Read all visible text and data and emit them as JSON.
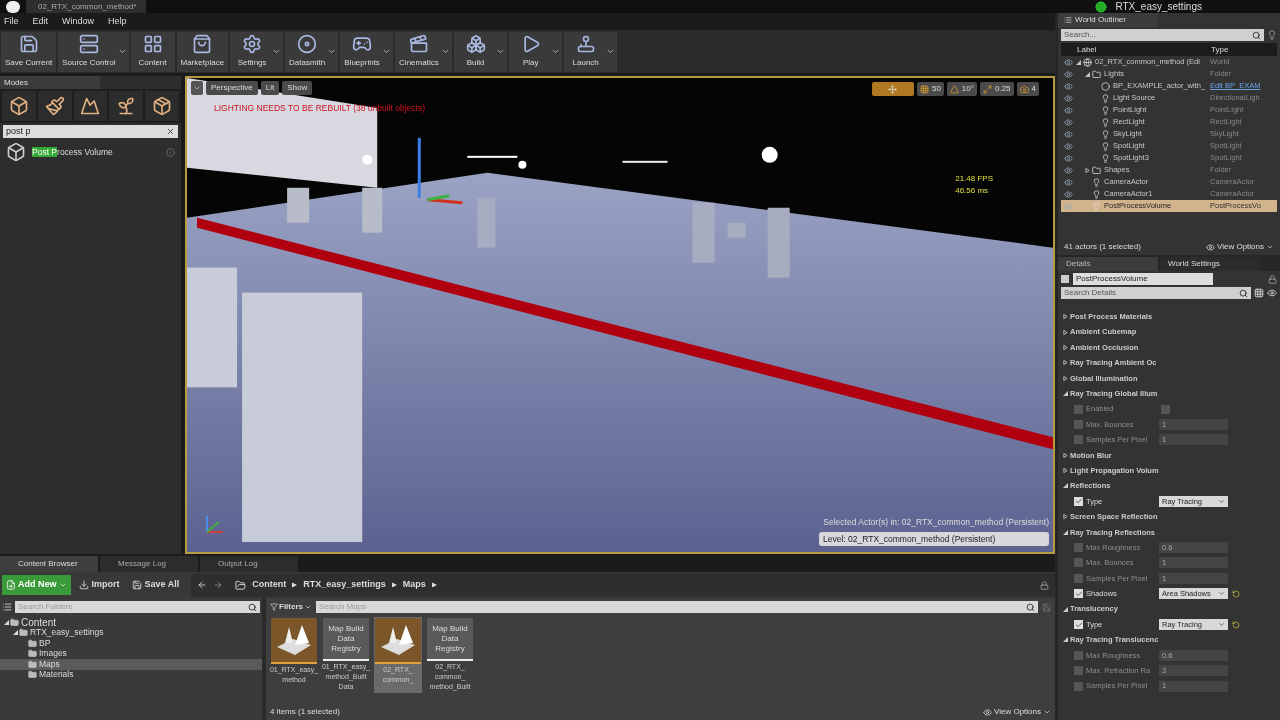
{
  "window": {
    "title": "02_RTX_common_method*",
    "project": "RTX_easy_settings"
  },
  "menu": [
    "File",
    "Edit",
    "Window",
    "Help"
  ],
  "toolbar": [
    {
      "label": "Save Current",
      "dropdown": false
    },
    {
      "label": "Source Control",
      "dropdown": true
    },
    {
      "label": "Content",
      "dropdown": false
    },
    {
      "label": "Marketplace",
      "dropdown": false
    },
    {
      "label": "Settings",
      "dropdown": true
    },
    {
      "label": "Datasmith",
      "dropdown": true
    },
    {
      "label": "Blueprints",
      "dropdown": true
    },
    {
      "label": "Cinematics",
      "dropdown": true
    },
    {
      "label": "Build",
      "dropdown": true
    },
    {
      "label": "Play",
      "dropdown": true
    },
    {
      "label": "Launch",
      "dropdown": true
    }
  ],
  "modes": {
    "tab": "Modes",
    "search": "post p",
    "results": [
      {
        "match": "Post P",
        "rest": "rocess Volume"
      }
    ]
  },
  "viewport": {
    "view_buttons": [
      "Perspective",
      "Lit",
      "Show"
    ],
    "warning": "LIGHTING NEEDS TO BE REBUILT (38 unbuilt objects)",
    "snap": [
      "50",
      "10°",
      "0.25",
      "4"
    ],
    "stats": [
      "21.48 FPS",
      "46.56 ms"
    ],
    "selected_actor": "Selected Actor(s) in:  02_RTX_common_method (Persistent)",
    "level": "Level:  02_RTX_common_method (Persistent)"
  },
  "outliner": {
    "tab": "World Outliner",
    "search_placeholder": "Search...",
    "columns": [
      "Label",
      "Type"
    ],
    "rows": [
      {
        "label": "02_RTX_common_method (Edi",
        "type": "World",
        "type_is_link": false,
        "selected": false,
        "expanded": true,
        "children": [
          {
            "label": "Lights",
            "type": "Folder",
            "type_is_link": false,
            "selected": false,
            "expanded": true,
            "children": [
              {
                "label": "BP_EXAMPLE_actor_with_",
                "type": "Edit BP_EXAM",
                "type_is_link": true,
                "selected": false
              },
              {
                "label": "Light Source",
                "type": "DirectionalLigh",
                "type_is_link": false,
                "selected": false
              },
              {
                "label": "PointLight",
                "type": "PointLight",
                "type_is_link": false,
                "selected": false
              },
              {
                "label": "RectLight",
                "type": "RectLight",
                "type_is_link": false,
                "selected": false
              },
              {
                "label": "SkyLight",
                "type": "SkyLight",
                "type_is_link": false,
                "selected": false
              },
              {
                "label": "SpotLight",
                "type": "SpotLight",
                "type_is_link": false,
                "selected": false
              },
              {
                "label": "SpotLight3",
                "type": "SpotLight",
                "type_is_link": false,
                "selected": false
              }
            ]
          },
          {
            "label": "Shapes",
            "type": "Folder",
            "type_is_link": false,
            "selected": false,
            "expanded": false
          },
          {
            "label": "CameraActor",
            "type": "CameraActor",
            "type_is_link": false,
            "selected": false
          },
          {
            "label": "CameraActor1",
            "type": "CameraActor",
            "type_is_link": false,
            "selected": false
          },
          {
            "label": "PostProcessVolume",
            "type": "PostProcessVo",
            "type_is_link": false,
            "selected": true
          }
        ]
      }
    ],
    "status": "41 actors (1 selected)",
    "view_options": "View Options"
  },
  "details": {
    "tabs": [
      {
        "label": "Details",
        "selected": true
      },
      {
        "label": "World Settings",
        "selected": false
      }
    ],
    "actor_name": "PostProcessVolume",
    "search_placeholder": "Search Details",
    "rows": [
      {
        "kind": "category",
        "label": "Post Process Materials",
        "expanded": false
      },
      {
        "kind": "category",
        "label": "Ambient Cubemap",
        "expanded": false
      },
      {
        "kind": "category",
        "label": "Ambient Occlusion",
        "expanded": false
      },
      {
        "kind": "category",
        "label": "Ray Tracing Ambient Oc",
        "expanded": false
      },
      {
        "kind": "category",
        "label": "Global Illumination",
        "expanded": false
      },
      {
        "kind": "category",
        "label": "Ray Tracing Global Illum",
        "expanded": true
      },
      {
        "kind": "checkbox_property",
        "label": "Enabled",
        "checked": false,
        "enabled": false,
        "value_checked": false,
        "reset": false
      },
      {
        "kind": "number_property",
        "label": "Max. Bounces",
        "checked": false,
        "enabled": false,
        "value": "1",
        "reset": false
      },
      {
        "kind": "number_property",
        "label": "Samples Per Pixel",
        "checked": false,
        "enabled": false,
        "value": "1",
        "reset": false
      },
      {
        "kind": "category",
        "label": "Motion Blur",
        "expanded": false
      },
      {
        "kind": "category",
        "label": "Light Propagation Volum",
        "expanded": false
      },
      {
        "kind": "category",
        "label": "Reflections",
        "expanded": true
      },
      {
        "kind": "dropdown_property",
        "label": "Type",
        "checked": true,
        "enabled": true,
        "value": "Ray Tracing",
        "reset": false
      },
      {
        "kind": "category",
        "label": "Screen Space Reflection",
        "expanded": false
      },
      {
        "kind": "category",
        "label": "Ray Tracing Reflections",
        "expanded": true
      },
      {
        "kind": "number_property",
        "label": "Max Roughness",
        "checked": false,
        "enabled": false,
        "value": "0.6",
        "reset": false
      },
      {
        "kind": "number_property",
        "label": "Max. Bounces",
        "checked": false,
        "enabled": false,
        "value": "1",
        "reset": false
      },
      {
        "kind": "number_property",
        "label": "Samples Per Pixel",
        "checked": false,
        "enabled": false,
        "value": "1",
        "reset": false
      },
      {
        "kind": "dropdown_property",
        "label": "Shadows",
        "checked": true,
        "enabled": true,
        "value": "Area Shadows",
        "reset": true
      },
      {
        "kind": "category",
        "label": "Translucency",
        "expanded": true
      },
      {
        "kind": "dropdown_property",
        "label": "Type",
        "checked": true,
        "enabled": true,
        "value": "Ray Tracing",
        "reset": true
      },
      {
        "kind": "category",
        "label": "Ray Tracing Translucenc",
        "expanded": true
      },
      {
        "kind": "number_property",
        "label": "Max Roughness",
        "checked": false,
        "enabled": false,
        "value": "0.6",
        "reset": false
      },
      {
        "kind": "number_property",
        "label": "Max. Refraction Ra",
        "checked": false,
        "enabled": false,
        "value": "3",
        "reset": false
      },
      {
        "kind": "number_property",
        "label": "Samples Per Pixel",
        "checked": false,
        "enabled": false,
        "value": "1",
        "reset": false
      }
    ]
  },
  "content_browser": {
    "tabs": [
      {
        "label": "Content Browser",
        "selected": true
      },
      {
        "label": "Message Log",
        "selected": false
      },
      {
        "label": "Output Log",
        "selected": false
      }
    ],
    "buttons": [
      "Add New",
      "Import",
      "Save All"
    ],
    "path": [
      "Content",
      "RTX_easy_settings",
      "Maps"
    ],
    "folder_search_placeholder": "Search Folders",
    "folders": [
      {
        "label": "Content",
        "selected": false,
        "expanded": true,
        "children": [
          {
            "label": "RTX_easy_settings",
            "selected": false,
            "expanded": true,
            "children": [
              {
                "label": "BP",
                "selected": false
              },
              {
                "label": "Images",
                "selected": false
              },
              {
                "label": "Maps",
                "selected": true
              },
              {
                "label": "Materials",
                "selected": false
              }
            ]
          }
        ]
      }
    ],
    "filters": "Filters",
    "asset_search_placeholder": "Search Maps",
    "assets": [
      {
        "kind": "map",
        "name": "01_RTX_easy_ method",
        "selected": false
      },
      {
        "kind": "registry",
        "thumb_text": "Map Build Data Registry",
        "name": "01_RTX_easy_ method_Built Data",
        "selected": false
      },
      {
        "kind": "map",
        "name": "02_RTX_ common_",
        "selected": true
      },
      {
        "kind": "registry",
        "thumb_text": "Map Build Data Registry",
        "name": "02_RTX_ common_ method_Built",
        "selected": false
      }
    ],
    "status": "4 items (1 selected)",
    "view_options": "View Options"
  }
}
